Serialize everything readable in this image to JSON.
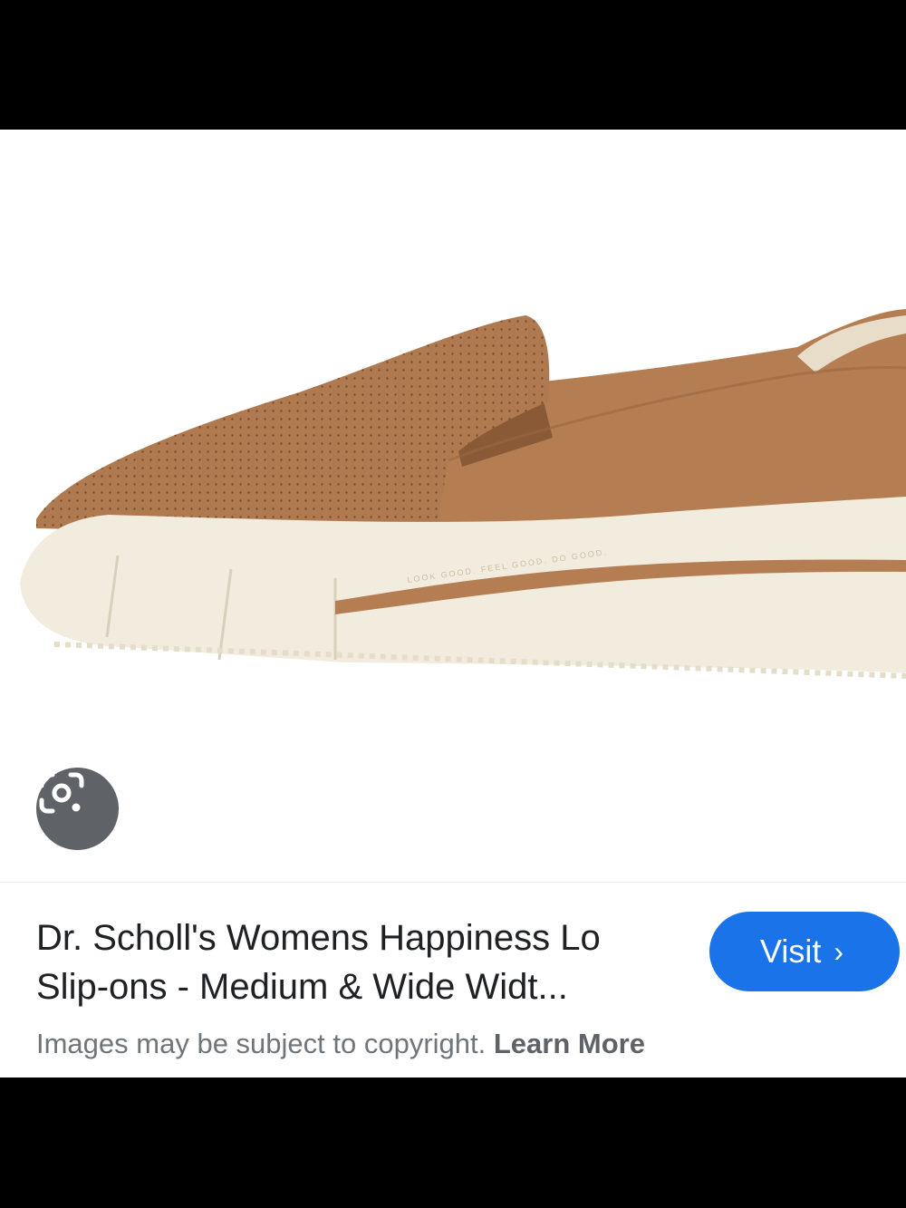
{
  "result": {
    "title_line1": "Dr. Scholl's Womens Happiness Lo",
    "title_line2": "Slip-ons - Medium & Wide Widt...",
    "visit_label": "Visit",
    "visit_chevron": "›",
    "copyright_text": "Images may be subject to copyright.",
    "learn_more": "Learn More"
  },
  "image": {
    "sole_imprint": "LOOK GOOD. FEEL GOOD. DO GOOD.",
    "upper_color": "#b07a50",
    "sole_color": "#f1ecdd"
  },
  "icons": {
    "lens": "google-lens-icon"
  },
  "colors": {
    "accent": "#1a73e8",
    "lens_bg": "#5f6368"
  }
}
